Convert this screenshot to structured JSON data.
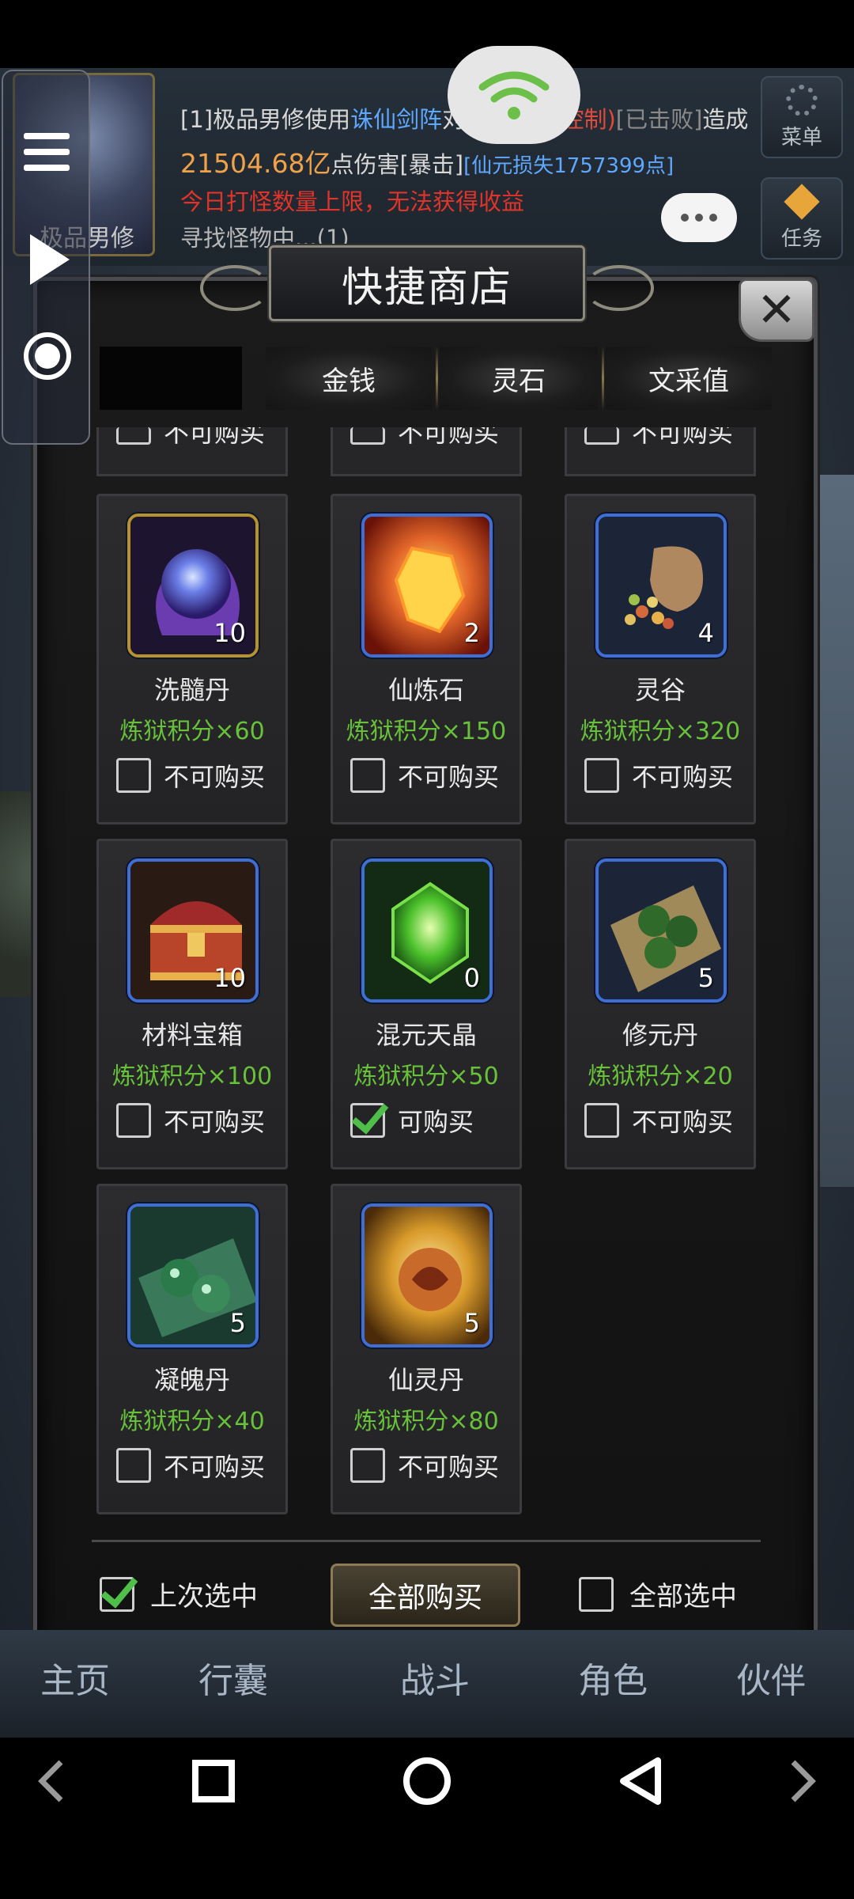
{
  "header": {
    "avatar_name": "极品男修",
    "log1": {
      "prefix": "[1]极品男修使用",
      "skill": "诛仙剑阵",
      "skill_tail": "对",
      "target": "(控制)",
      "result": "[已击败]",
      "suffix": "造成"
    },
    "log2": {
      "damage": "21504.68亿",
      "text": "点伤害[暴击]",
      "loss": "[仙元损失1757399点]"
    },
    "log3": "今日打怪数量上限，无法获得收益",
    "log4": "寻找怪物中...(1)",
    "menu_label": "菜单",
    "task_label": "任务"
  },
  "shop": {
    "title": "快捷商店",
    "tabs": [
      "",
      "金钱",
      "灵石",
      "文采值"
    ],
    "partial_row_label": "不可购买",
    "items": [
      {
        "name": "洗髓丹",
        "price": "炼狱积分×60",
        "count": "10",
        "buy_label": "不可购买",
        "checked": false,
        "icon": "purple-orb-icon"
      },
      {
        "name": "仙炼石",
        "price": "炼狱积分×150",
        "count": "2",
        "buy_label": "不可购买",
        "checked": false,
        "icon": "fire-crystal-icon"
      },
      {
        "name": "灵谷",
        "price": "炼狱积分×320",
        "count": "4",
        "buy_label": "不可购买",
        "checked": false,
        "icon": "grain-sack-icon"
      },
      {
        "name": "材料宝箱",
        "price": "炼狱积分×100",
        "count": "10",
        "buy_label": "不可购买",
        "checked": false,
        "icon": "treasure-chest-icon"
      },
      {
        "name": "混元天晶",
        "price": "炼狱积分×50",
        "count": "0",
        "buy_label": "可购买",
        "checked": true,
        "icon": "green-gem-icon"
      },
      {
        "name": "修元丹",
        "price": "炼狱积分×20",
        "count": "5",
        "buy_label": "不可购买",
        "checked": false,
        "icon": "green-pills-icon"
      },
      {
        "name": "凝魄丹",
        "price": "炼狱积分×40",
        "count": "5",
        "buy_label": "不可购买",
        "checked": false,
        "icon": "jade-pills-icon"
      },
      {
        "name": "仙灵丹",
        "price": "炼狱积分×80",
        "count": "5",
        "buy_label": "不可购买",
        "checked": false,
        "icon": "golden-pill-icon"
      }
    ],
    "footer": {
      "last_selected_label": "上次选中",
      "last_selected_checked": true,
      "buy_all_label": "全部购买",
      "select_all_label": "全部选中",
      "select_all_checked": false
    }
  },
  "bottom_nav": [
    "主页",
    "行囊",
    "战斗",
    "角色",
    "伙伴"
  ],
  "colors": {
    "price_green": "#67c23a",
    "log_red": "#e0342a",
    "damage_gold": "#f0a24a",
    "skill_blue": "#5fa8ff",
    "frame_blue": "#3f6fd6"
  }
}
